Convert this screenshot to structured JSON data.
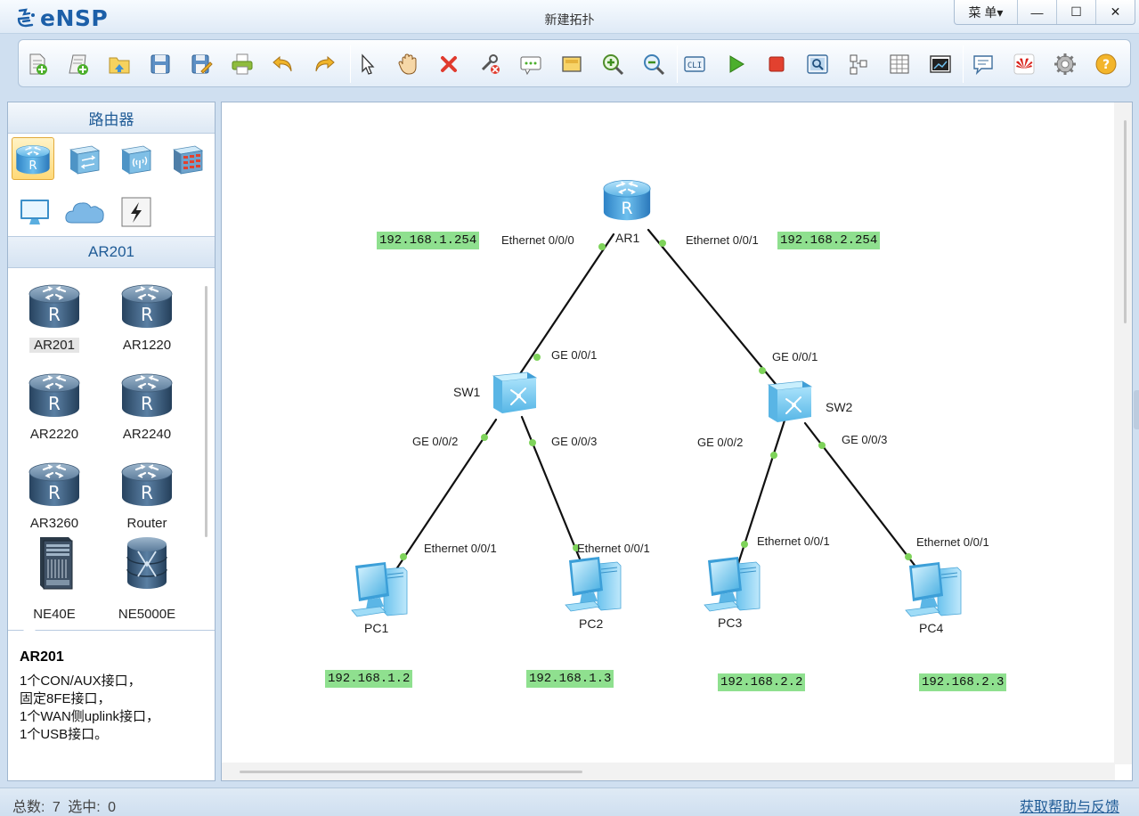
{
  "app": {
    "name": "eNSP",
    "window_title": "新建拓扑",
    "menu_label": "菜 单▾",
    "minimize_label": "—",
    "maximize_label": "☐",
    "close_label": "✕"
  },
  "toolbar": {
    "icons": [
      "new-topology-icon",
      "new-lab-icon",
      "open-icon",
      "save-icon",
      "save-as-icon",
      "print-icon",
      "undo-icon",
      "redo-icon",
      "select-icon",
      "hand-icon",
      "delete-icon",
      "delete-link-icon",
      "text-icon",
      "rectangle-icon",
      "zoom-in-icon",
      "zoom-out-icon",
      "console-icon",
      "start-device-icon",
      "stop-device-icon",
      "capture-icon",
      "topology-icon",
      "table-icon",
      "fullscreen-icon",
      "chat-icon",
      "huawei-icon",
      "settings-icon",
      "help-icon"
    ]
  },
  "sidebar": {
    "category_title": "路由器",
    "categories": [
      "router-category-icon",
      "switch-category-icon",
      "wireless-category-icon",
      "firewall-category-icon",
      "terminal-category-icon",
      "cloud-category-icon",
      "link-category-icon"
    ],
    "model_title": "AR201",
    "devices": [
      {
        "name": "AR201",
        "kind": "router"
      },
      {
        "name": "AR1220",
        "kind": "router"
      },
      {
        "name": "AR2220",
        "kind": "router"
      },
      {
        "name": "AR2240",
        "kind": "router"
      },
      {
        "name": "AR3260",
        "kind": "router"
      },
      {
        "name": "Router",
        "kind": "router"
      },
      {
        "name": "NE40E",
        "kind": "chassis"
      },
      {
        "name": "NE5000E",
        "kind": "cluster"
      }
    ],
    "description": {
      "title": "AR201",
      "lines": [
        "1个CON/AUX接口，",
        "固定8FE接口，",
        "1个WAN侧uplink接口，",
        "1个USB接口。"
      ]
    }
  },
  "topology": {
    "devices": {
      "ar1": "AR1",
      "sw1": "SW1",
      "sw2": "SW2",
      "pc1": "PC1",
      "pc2": "PC2",
      "pc3": "PC3",
      "pc4": "PC4"
    },
    "ports": {
      "ar1_left": "Ethernet 0/0/0",
      "ar1_right": "Ethernet 0/0/1",
      "sw1_up": "GE 0/0/1",
      "sw1_left": "GE 0/0/2",
      "sw1_right": "GE 0/0/3",
      "sw2_up": "GE 0/0/1",
      "sw2_left": "GE 0/0/2",
      "sw2_right": "GE 0/0/3",
      "pc1_eth": "Ethernet 0/0/1",
      "pc2_eth": "Ethernet 0/0/1",
      "pc3_eth": "Ethernet 0/0/1",
      "pc4_eth": "Ethernet 0/0/1"
    },
    "ip_tags": {
      "gw1": "192.168.1.254",
      "gw2": "192.168.2.254",
      "pc1": "192.168.1.2",
      "pc2": "192.168.1.3",
      "pc3": "192.168.2.2",
      "pc4": "192.168.2.3"
    },
    "link_color": "#111111",
    "port_dot_color": "#7ed35a",
    "ip_tag_color": "#8fe08f"
  },
  "status": {
    "total_label": "总数:",
    "total_value": "7",
    "selected_label": "选中:",
    "selected_value": "0",
    "help_link": "获取帮助与反馈"
  }
}
